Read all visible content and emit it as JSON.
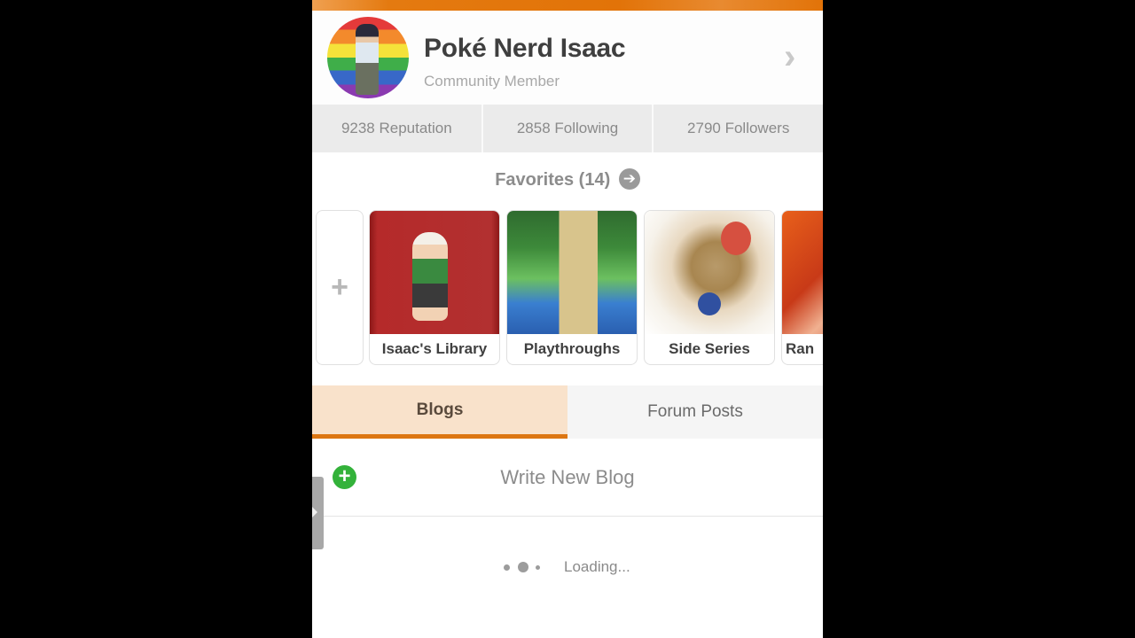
{
  "profile": {
    "username": "Poké Nerd Isaac",
    "role": "Community Member",
    "chevron_icon": "chevron-right-icon"
  },
  "stats": [
    {
      "label": "9238 Reputation"
    },
    {
      "label": "2858 Following"
    },
    {
      "label": "2790 Followers"
    }
  ],
  "favorites": {
    "title": "Favorites (14)",
    "arrow_glyph": "➔",
    "add_glyph": "+",
    "items": [
      {
        "label": "Isaac's Library"
      },
      {
        "label": "Playthroughs"
      },
      {
        "label": "Side Series"
      },
      {
        "label": "Ran"
      }
    ]
  },
  "tabs": [
    {
      "label": "Blogs",
      "active": true
    },
    {
      "label": "Forum Posts",
      "active": false
    }
  ],
  "write_blog": {
    "plus_glyph": "+",
    "label": "Write New Blog"
  },
  "loading": {
    "text": "Loading..."
  },
  "colors": {
    "accent": "#dd7612",
    "active_tab_bg": "#f9e2cb",
    "add_green": "#33b23a"
  }
}
